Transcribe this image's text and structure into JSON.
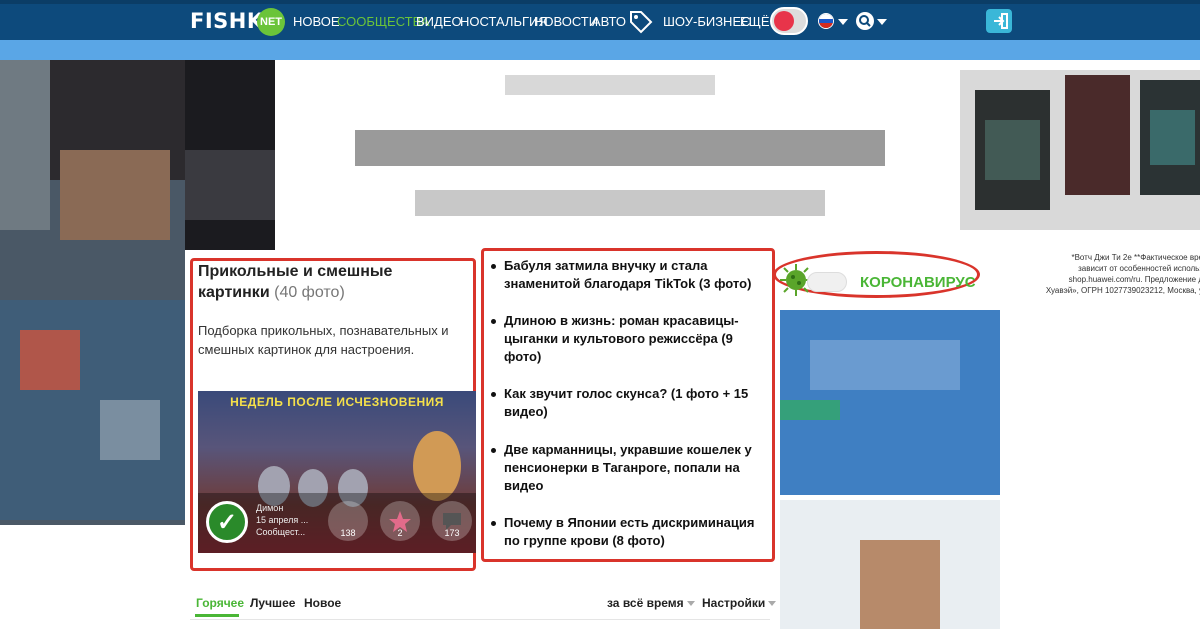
{
  "header": {
    "logo_text": "FISHKI",
    "logo_badge": "NET",
    "nav": [
      {
        "label": "НОВОЕ",
        "active": false
      },
      {
        "label": "СООБЩЕСТВА",
        "active": true
      },
      {
        "label": "ВИДЕО",
        "active": false
      },
      {
        "label": "НОСТАЛЬГИЯ",
        "active": false
      },
      {
        "label": "НОВОСТИ",
        "active": false
      },
      {
        "label": "АВТО",
        "active": false
      },
      {
        "label": "ШОУ-БИЗНЕС",
        "active": false
      },
      {
        "label": "ЕЩЁ",
        "active": false
      }
    ],
    "icons": [
      "tag-icon",
      "user-avatar",
      "russia-flag-icon",
      "search-icon",
      "login-icon"
    ]
  },
  "colors": {
    "nav_bg": "#0d4a7c",
    "accent_green": "#4ab636",
    "highlight_red": "#d9342b"
  },
  "left_card": {
    "title": "Прикольные и смешные картинки",
    "count": "(40 фото)",
    "description": "Подборка прикольных, познавательных и смешных картинок для настроения.",
    "image_headline": "НЕДЕЛЬ ПОСЛЕ ИСЧЕЗНОВЕНИЯ",
    "author": "Димон",
    "date": "15 апреля ...",
    "section": "Сообщест...",
    "stats": {
      "views": "138",
      "favorites": "2",
      "comments": "173"
    }
  },
  "news_list": [
    "Бабуля затмила внучку и стала знаменитой благодаря TikTok (3 фото)",
    "Длиною в жизнь: роман красавицы-цыганки и культового режиссёра (9 фото)",
    "Как звучит голос скунса? (1 фото + 15 видео)",
    "Две карманницы, укравшие кошелек у пенсионерки в Таганроге, попали на видео",
    "Почему в Японии есть дискриминация по группе крови (8 фото)"
  ],
  "corona": {
    "label": "КОРОНАВИРУС"
  },
  "fine_print": [
    "*Вотч Джи Ти 2е **Фактическое вре",
    "зависит от особенностей использ",
    "shop.huawei.com/ru. Предложение д",
    "Хуавэй», ОГРН 1027739023212, Москва, у"
  ],
  "tabs": {
    "items": [
      "Горячее",
      "Лучшее",
      "Новое"
    ],
    "active_index": 0,
    "period": "за всё время",
    "settings": "Настройки"
  }
}
